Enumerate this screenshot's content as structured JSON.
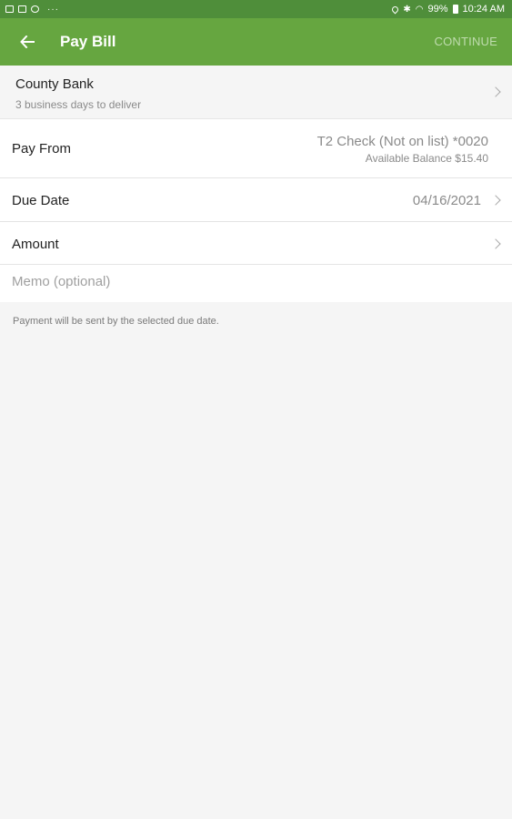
{
  "status_bar": {
    "battery": "99%",
    "time": "10:24 AM",
    "more": "···"
  },
  "app_bar": {
    "title": "Pay Bill",
    "continue_label": "CONTINUE",
    "back_icon": "arrow-left-icon"
  },
  "payee": {
    "name": "County Bank",
    "delivery": "3 business days to deliver"
  },
  "pay_from": {
    "label": "Pay From",
    "account": "T2 Check (Not on list) *0020",
    "balance": "Available Balance $15.40"
  },
  "due_date": {
    "label": "Due Date",
    "value": "04/16/2021"
  },
  "amount": {
    "label": "Amount",
    "value": ""
  },
  "memo": {
    "placeholder": "Memo (optional)",
    "value": ""
  },
  "note": "Payment will be sent by the selected due date.",
  "colors": {
    "status_bar": "#4f8e3a",
    "app_bar": "#66a640",
    "continue_disabled": "#bfdcae",
    "background": "#f5f5f5"
  }
}
